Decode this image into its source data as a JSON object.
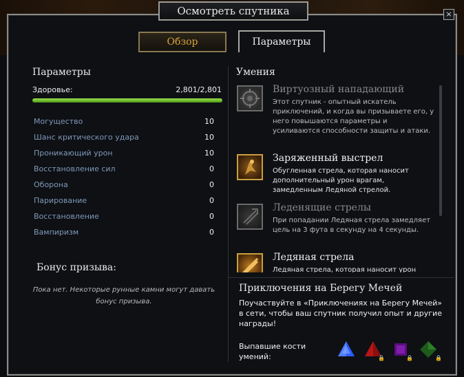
{
  "window": {
    "title": "Осмотреть спутника",
    "close_label": "×"
  },
  "tabs": [
    {
      "label": "Обзор",
      "active": false
    },
    {
      "label": "Параметры",
      "active": true
    }
  ],
  "stats": {
    "title": "Параметры",
    "health_label": "Здоровье:",
    "health_value": "2,801/2,801",
    "health_fill": 1.0,
    "rows": [
      {
        "name": "Могущество",
        "value": "10"
      },
      {
        "name": "Шанс критического удара",
        "value": "10"
      },
      {
        "name": "Проникающий урон",
        "value": "10"
      },
      {
        "name": "Восстановление сил",
        "value": "0"
      },
      {
        "name": "Оборона",
        "value": "0"
      },
      {
        "name": "Парирование",
        "value": "0"
      },
      {
        "name": "Восстановление",
        "value": "0"
      },
      {
        "name": "Вампиризм",
        "value": "0"
      }
    ]
  },
  "bonus": {
    "title": "Бонус призыва:",
    "text": "Пока нет. Некоторые рунные камни могут давать бонус призыва."
  },
  "skills": {
    "title": "Умения",
    "items": [
      {
        "name": "Виртуозный нападающий",
        "desc": "Этот спутник - опытный искатель приключений, и когда вы призываете его, у него повышаются параметры и усиливаются способности защиты и атаки.",
        "icon": "gear-emblem-icon",
        "active": false
      },
      {
        "name": "Заряженный выстрел",
        "desc": "Обугленная стрела, которая наносит дополнительный урон врагам, замедленным Ледяной стрелой.",
        "icon": "archer-icon",
        "active": true
      },
      {
        "name": "Леденящие стрелы",
        "desc": "При попадании Ледяная стрела замедляет цель на 3 фута в секунду на 4 секунды.",
        "icon": "frost-arrows-icon",
        "active": false
      },
      {
        "name": "Ледяная стрела",
        "desc": "Ледяная стрела, которая наносит урон",
        "icon": "ice-arrow-icon",
        "active": true
      }
    ]
  },
  "adventures": {
    "title": "Приключения на Берегу Мечей",
    "desc": "Поучаствуйте в «Приключениях на Берегу Мечей» в сети, чтобы ваш спутник получил опыт и другие награды!",
    "dice_label": "Выпавшие кости умений:",
    "dice": [
      {
        "icon": "blue-die-icon",
        "color": "#2d5cff",
        "locked": false
      },
      {
        "icon": "red-die-icon",
        "color": "#c01818",
        "locked": true
      },
      {
        "icon": "purple-die-icon",
        "color": "#8a1fb8",
        "locked": true
      },
      {
        "icon": "green-die-icon",
        "color": "#2f8a2a",
        "locked": true
      }
    ]
  }
}
